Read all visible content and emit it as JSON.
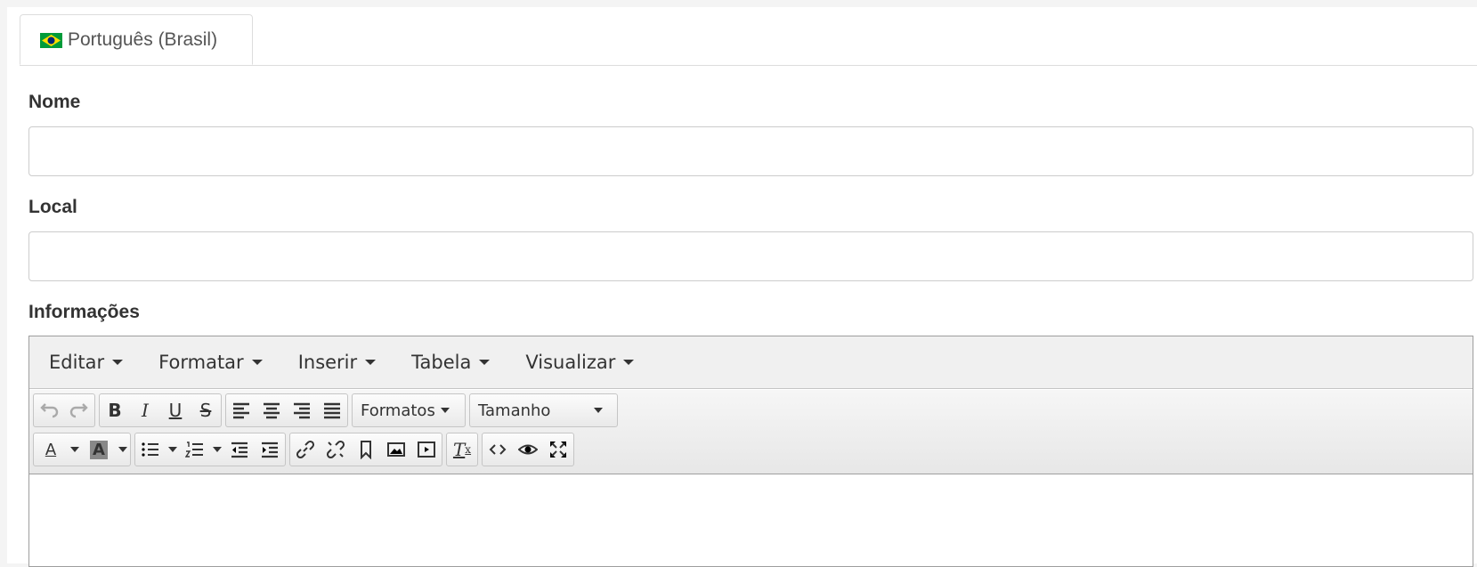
{
  "tab": {
    "flag_icon": "flag-brazil-icon",
    "label": "Português (Brasil)"
  },
  "fields": {
    "nome_label": "Nome",
    "nome_value": "",
    "local_label": "Local",
    "local_value": "",
    "informacoes_label": "Informações"
  },
  "editor": {
    "menus": [
      "Editar",
      "Formatar",
      "Inserir",
      "Tabela",
      "Visualizar"
    ],
    "formats_label": "Formatos",
    "size_label": "Tamanho",
    "toolbar_icons_row1": [
      "undo-icon",
      "redo-icon",
      "bold-icon",
      "italic-icon",
      "underline-icon",
      "strikethrough-icon",
      "align-left-icon",
      "align-center-icon",
      "align-right-icon",
      "align-justify-icon"
    ],
    "toolbar_icons_row2": [
      "text-color-icon",
      "background-color-icon",
      "bullet-list-icon",
      "numbered-list-icon",
      "outdent-icon",
      "indent-icon",
      "link-icon",
      "unlink-icon",
      "anchor-icon",
      "image-icon",
      "media-icon",
      "clear-formatting-icon",
      "code-icon",
      "preview-icon",
      "fullscreen-icon"
    ],
    "content": ""
  },
  "colors": {
    "tab_border": "#dddddd",
    "input_border": "#cccccc",
    "editor_border": "#9e9e9e"
  }
}
